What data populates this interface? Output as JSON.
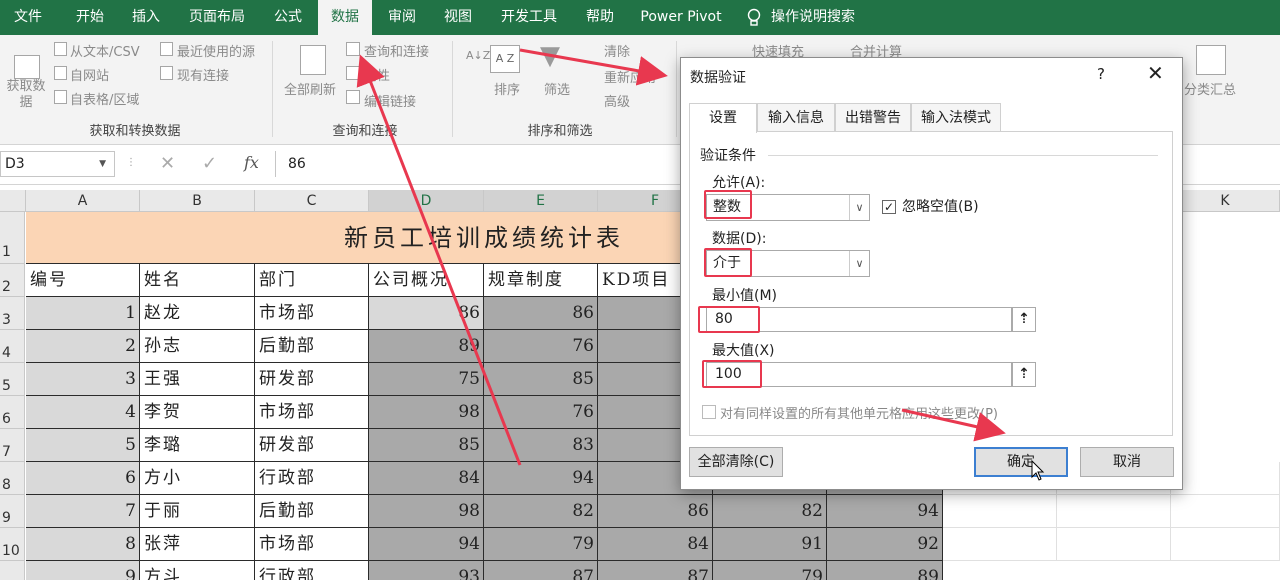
{
  "ribbon_tabs": [
    "文件",
    "开始",
    "插入",
    "页面布局",
    "公式",
    "数据",
    "审阅",
    "视图",
    "开发工具",
    "帮助",
    "Power Pivot",
    "操作说明搜索"
  ],
  "ribbon": {
    "get_data": "获取数\n据",
    "from_text_csv": "从文本/CSV",
    "from_web": "自网站",
    "from_table": "自表格/区域",
    "recent_sources": "最近使用的源",
    "existing_connections": "现有连接",
    "group_get_transform": "获取和转换数据",
    "refresh_all": "全部刷新",
    "queries_connections": "查询和连接",
    "properties": "属性",
    "edit_links": "编辑链接",
    "group_queries": "查询和连接",
    "sort_az": "A Z",
    "sort": "排序",
    "filter": "筛选",
    "clear": "清除",
    "reapply": "重新应用",
    "advanced": "高级",
    "group_sort_filter": "排序和筛选",
    "flash_fill": "快速填充",
    "consolidate": "合并计算",
    "subtotal": "分类汇总"
  },
  "formula_bar": {
    "name_box": "D3",
    "cancel": "✕",
    "enter": "✓",
    "fx": "fx",
    "value": "86"
  },
  "columns": [
    "A",
    "B",
    "C",
    "D",
    "E",
    "F",
    "",
    "",
    "K"
  ],
  "rows": [
    "1",
    "2",
    "3",
    "4",
    "5",
    "6",
    "7",
    "8",
    "9",
    "10"
  ],
  "table": {
    "title": "新员工培训成绩统计表",
    "headers": [
      "编号",
      "姓名",
      "部门",
      "公司概况",
      "规章制度",
      "KD项目"
    ],
    "records": [
      {
        "no": "1",
        "name": "赵龙",
        "dept": "市场部",
        "d": "86",
        "e": "86",
        "f": "",
        "g": "",
        "h": ""
      },
      {
        "no": "2",
        "name": "孙志",
        "dept": "后勤部",
        "d": "89",
        "e": "76",
        "f": "",
        "g": "",
        "h": ""
      },
      {
        "no": "3",
        "name": "王强",
        "dept": "研发部",
        "d": "75",
        "e": "85",
        "f": "",
        "g": "",
        "h": ""
      },
      {
        "no": "4",
        "name": "李贺",
        "dept": "市场部",
        "d": "98",
        "e": "76",
        "f": "",
        "g": "",
        "h": ""
      },
      {
        "no": "5",
        "name": "李璐",
        "dept": "研发部",
        "d": "85",
        "e": "83",
        "f": "",
        "g": "",
        "h": ""
      },
      {
        "no": "6",
        "name": "方小",
        "dept": "行政部",
        "d": "84",
        "e": "94",
        "f": "",
        "g": "",
        "h": ""
      },
      {
        "no": "7",
        "name": "于丽",
        "dept": "后勤部",
        "d": "98",
        "e": "82",
        "f": "86",
        "g": "82",
        "h": "94"
      },
      {
        "no": "8",
        "name": "张萍",
        "dept": "市场部",
        "d": "94",
        "e": "79",
        "f": "84",
        "g": "91",
        "h": "92"
      },
      {
        "no": "9",
        "name": "方斗",
        "dept": "行政部",
        "d": "93",
        "e": "87",
        "f": "87",
        "g": "79",
        "h": "89"
      }
    ]
  },
  "dialog": {
    "title": "数据验证",
    "help": "?",
    "close": "✕",
    "tabs": [
      "设置",
      "输入信息",
      "出错警告",
      "输入法模式"
    ],
    "section": "验证条件",
    "allow_label": "允许(A):",
    "allow_value": "整数",
    "ignore_blank": "忽略空值(B)",
    "data_label": "数据(D):",
    "data_value": "介于",
    "min_label": "最小值(M)",
    "min_value": "80",
    "max_label": "最大值(X)",
    "max_value": "100",
    "apply_all": "对有同样设置的所有其他单元格应用这些更改(P)",
    "clear_all": "全部清除(C)",
    "ok": "确定",
    "cancel": "取消"
  },
  "colors": {
    "excel_green": "#217346",
    "annotation_red": "#e8384f",
    "title_fill": "#fbd5b5",
    "selected_fill": "#a9a9a9"
  }
}
